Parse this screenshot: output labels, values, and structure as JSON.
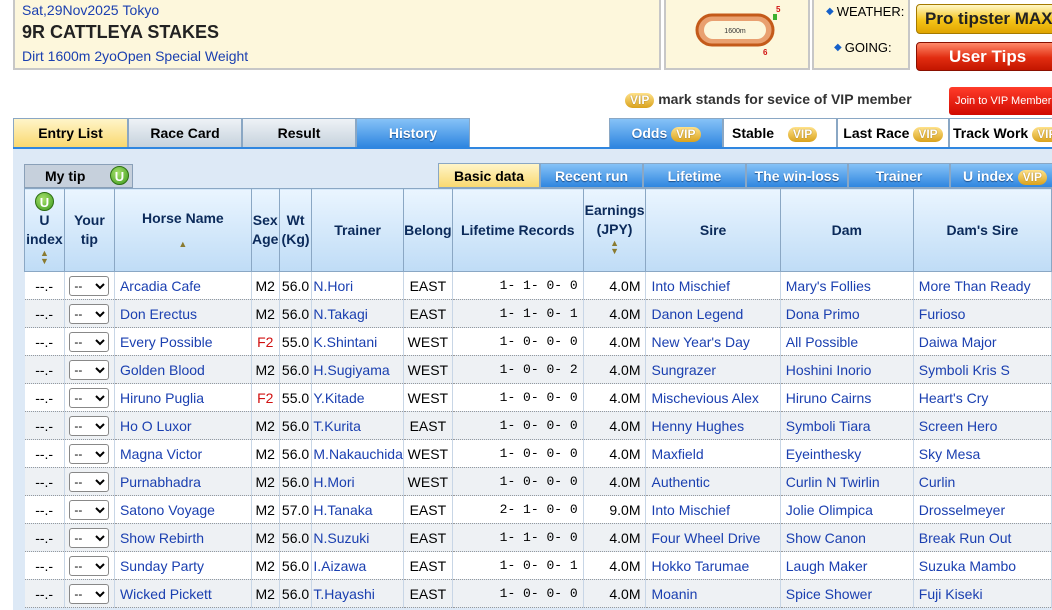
{
  "race": {
    "date": "Sat,29Nov2025",
    "venue": "Tokyo",
    "title": "9R CATTLEYA STAKES",
    "conditions": "Dirt 1600m 2yoOpen Special Weight",
    "course_distance": "1600m",
    "course_label_top": "5",
    "course_label_bottom": "6"
  },
  "weather_label": "WEATHER:",
  "going_label": "GOING:",
  "buttons": {
    "pro_tipster": "Pro tipster MAX",
    "user_tips": "User Tips",
    "join_vip": "Join to VIP Member"
  },
  "vip_badge": "VIP",
  "vip_note": "mark stands for sevice of VIP member",
  "main_tabs": [
    {
      "label": "Entry List",
      "state": "active"
    },
    {
      "label": "Race Card",
      "state": "gray"
    },
    {
      "label": "Result",
      "state": "gray"
    },
    {
      "label": "History",
      "state": "blue"
    }
  ],
  "vip_tabs": [
    {
      "label": "Odds",
      "vip": true
    },
    {
      "label": "Stable",
      "vip": true
    },
    {
      "label": "Last Race",
      "vip": true
    },
    {
      "label": "Track Work",
      "vip": true
    }
  ],
  "my_tip": "My tip",
  "u_icon": "U",
  "sub_tabs": [
    {
      "label": "Basic data",
      "active": true
    },
    {
      "label": "Recent run"
    },
    {
      "label": "Lifetime"
    },
    {
      "label": "The win-loss"
    },
    {
      "label": "Trainer"
    },
    {
      "label": "U index",
      "vip": true
    }
  ],
  "columns": {
    "u_index": "U index",
    "your_tip": "Your tip",
    "horse_name": "Horse Name",
    "sex_age": "Sex Age",
    "wt": "Wt (Kg)",
    "trainer": "Trainer",
    "belong": "Belong",
    "lifetime": "Lifetime Records",
    "earnings": "Earnings (JPY)",
    "sire": "Sire",
    "dam": "Dam",
    "dams_sire": "Dam's Sire"
  },
  "tip_default": "--",
  "horses": [
    {
      "u": "--.-",
      "name": "Arcadia Cafe",
      "sex": "M2",
      "wt": "56.0",
      "trainer": "N.Hori",
      "belong": "EAST",
      "rec": "1- 1- 0- 0",
      "earn": "4.0M",
      "sire": "Into Mischief",
      "dam": "Mary's Follies",
      "ds": "More Than Ready"
    },
    {
      "u": "--.-",
      "name": "Don Erectus",
      "sex": "M2",
      "wt": "56.0",
      "trainer": "N.Takagi",
      "belong": "EAST",
      "rec": "1- 1- 0- 1",
      "earn": "4.0M",
      "sire": "Danon Legend",
      "dam": "Dona Primo",
      "ds": "Furioso"
    },
    {
      "u": "--.-",
      "name": "Every Possible",
      "sex": "F2",
      "wt": "55.0",
      "trainer": "K.Shintani",
      "belong": "WEST",
      "rec": "1- 0- 0- 0",
      "earn": "4.0M",
      "sire": "New Year's Day",
      "dam": "All Possible",
      "ds": "Daiwa Major"
    },
    {
      "u": "--.-",
      "name": "Golden Blood",
      "sex": "M2",
      "wt": "56.0",
      "trainer": "H.Sugiyama",
      "belong": "WEST",
      "rec": "1- 0- 0- 2",
      "earn": "4.0M",
      "sire": "Sungrazer",
      "dam": "Hoshini Inorio",
      "ds": "Symboli Kris S"
    },
    {
      "u": "--.-",
      "name": "Hiruno Puglia",
      "sex": "F2",
      "wt": "55.0",
      "trainer": "Y.Kitade",
      "belong": "WEST",
      "rec": "1- 0- 0- 0",
      "earn": "4.0M",
      "sire": "Mischevious Alex",
      "dam": "Hiruno Cairns",
      "ds": "Heart's Cry"
    },
    {
      "u": "--.-",
      "name": "Ho O Luxor",
      "sex": "M2",
      "wt": "56.0",
      "trainer": "T.Kurita",
      "belong": "EAST",
      "rec": "1- 0- 0- 0",
      "earn": "4.0M",
      "sire": "Henny Hughes",
      "dam": "Symboli Tiara",
      "ds": "Screen Hero"
    },
    {
      "u": "--.-",
      "name": "Magna Victor",
      "sex": "M2",
      "wt": "56.0",
      "trainer": "M.Nakauchida",
      "belong": "WEST",
      "rec": "1- 0- 0- 0",
      "earn": "4.0M",
      "sire": "Maxfield",
      "dam": "Eyeinthesky",
      "ds": "Sky Mesa"
    },
    {
      "u": "--.-",
      "name": "Purnabhadra",
      "sex": "M2",
      "wt": "56.0",
      "trainer": "H.Mori",
      "belong": "WEST",
      "rec": "1- 0- 0- 0",
      "earn": "4.0M",
      "sire": "Authentic",
      "dam": "Curlin N Twirlin",
      "ds": "Curlin"
    },
    {
      "u": "--.-",
      "name": "Satono Voyage",
      "sex": "M2",
      "wt": "57.0",
      "trainer": "H.Tanaka",
      "belong": "EAST",
      "rec": "2- 1- 0- 0",
      "earn": "9.0M",
      "sire": "Into Mischief",
      "dam": "Jolie Olimpica",
      "ds": "Drosselmeyer"
    },
    {
      "u": "--.-",
      "name": "Show Rebirth",
      "sex": "M2",
      "wt": "56.0",
      "trainer": "N.Suzuki",
      "belong": "EAST",
      "rec": "1- 1- 0- 0",
      "earn": "4.0M",
      "sire": "Four Wheel Drive",
      "dam": "Show Canon",
      "ds": "Break Run Out"
    },
    {
      "u": "--.-",
      "name": "Sunday Party",
      "sex": "M2",
      "wt": "56.0",
      "trainer": "I.Aizawa",
      "belong": "EAST",
      "rec": "1- 0- 0- 1",
      "earn": "4.0M",
      "sire": "Hokko Tarumae",
      "dam": "Laugh Maker",
      "ds": "Suzuka Mambo"
    },
    {
      "u": "--.-",
      "name": "Wicked Pickett",
      "sex": "M2",
      "wt": "56.0",
      "trainer": "T.Hayashi",
      "belong": "EAST",
      "rec": "1- 0- 0- 0",
      "earn": "4.0M",
      "sire": "Moanin",
      "dam": "Spice Shower",
      "ds": "Fuji Kiseki"
    }
  ],
  "colors": {
    "link": "#1a3fb0",
    "female": "#d01010",
    "tab_blue": "#2f86e0",
    "tab_active": "#f9d970"
  }
}
